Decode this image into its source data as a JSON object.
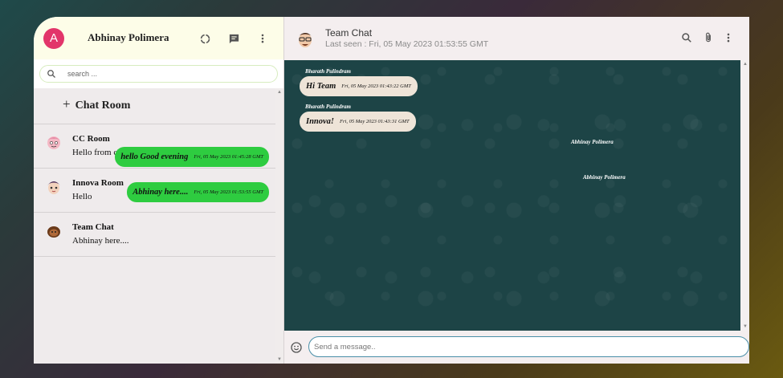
{
  "sidebar": {
    "avatar_letter": "A",
    "user_name": "Abhinay Polimera",
    "icons": [
      "status-icon",
      "new-chat-icon",
      "more-vert-icon"
    ],
    "search": {
      "placeholder": "search ..."
    },
    "add_room_label": "Chat Room",
    "rooms": [
      {
        "name": "CC Room",
        "last_message": "Hello from class"
      },
      {
        "name": "Innova Room",
        "last_message": "Hello"
      },
      {
        "name": "Team Chat",
        "last_message": "Abhinay here...."
      }
    ]
  },
  "chat": {
    "title": "Team Chat",
    "last_seen": "Last seen : Fri, 05 May 2023 01:53:55 GMT",
    "icons": [
      "search-icon",
      "attach-icon",
      "more-vert-icon"
    ],
    "messages": [
      {
        "sender": "Bharath Pulindram",
        "text": "Hi Team",
        "time": "Fri, 05 May 2023 01:43:22 GMT",
        "direction": "in"
      },
      {
        "sender": "Bharath Pulindram",
        "text": "Innova!",
        "time": "Fri, 05 May 2023 01:43:31 GMT",
        "direction": "in"
      },
      {
        "sender": "Abhinay Polimera",
        "text": "hello Good evening",
        "time": "Fri, 05 May 2023 01:45:28 GMT",
        "direction": "out"
      },
      {
        "sender": "Abhinay Polimera",
        "text": "Abhinay here....",
        "time": "Fri, 05 May 2023 01:53:55 GMT",
        "direction": "out"
      }
    ],
    "input_placeholder": "Send a message..",
    "colors": {
      "incoming": "#eee4d8",
      "outgoing": "#2ecc40",
      "background": "#1d4446"
    }
  }
}
